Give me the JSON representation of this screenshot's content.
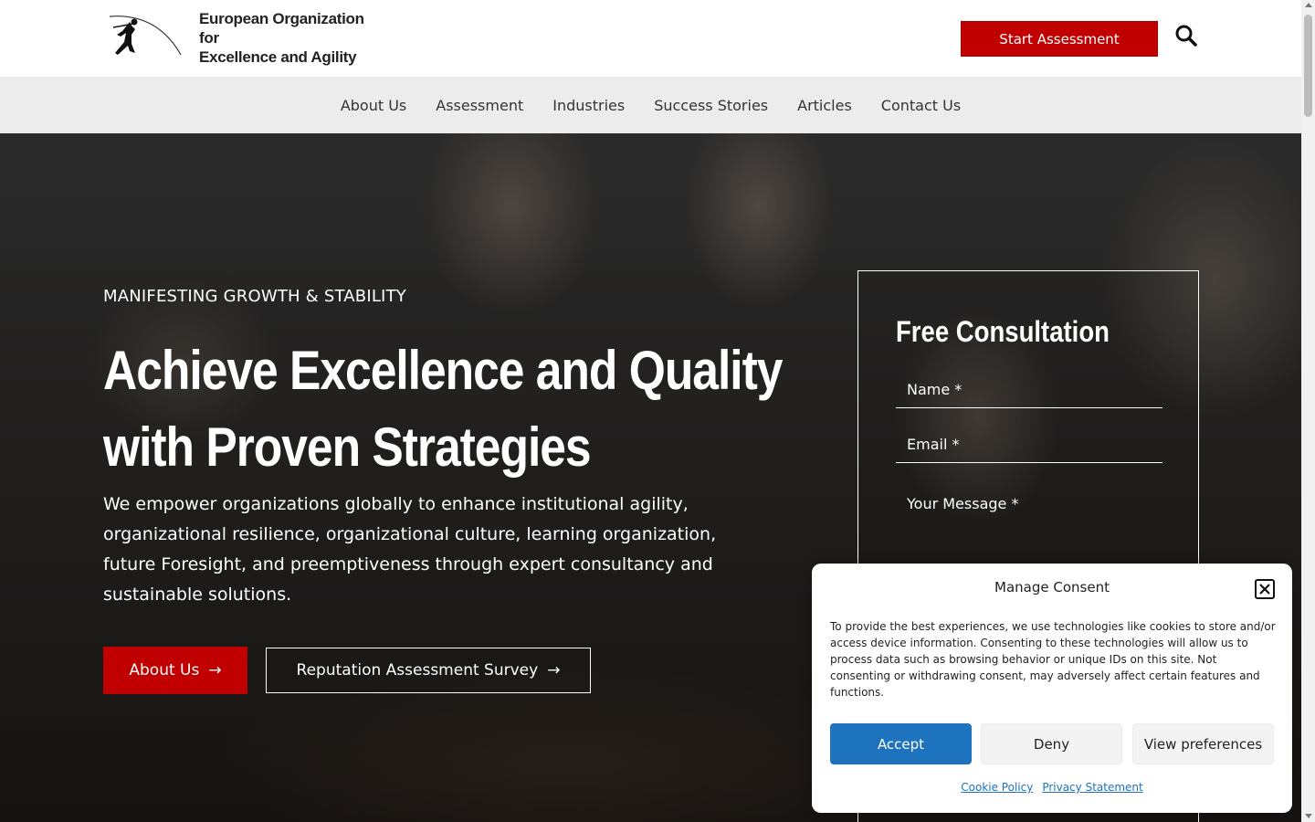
{
  "brand": {
    "name_line1": "European Organization for",
    "name_line2": "Excellence and Agility",
    "logo_icon": "pole-vaulter-icon"
  },
  "header": {
    "cta_label": "Start Assessment",
    "search_icon": "search-icon"
  },
  "nav": {
    "items": [
      "About Us",
      "Assessment",
      "Industries",
      "Success Stories",
      "Articles",
      "Contact Us"
    ]
  },
  "hero": {
    "kicker": "MANIFESTING GROWTH & STABILITY",
    "title": "Achieve Excellence and Quality with Proven Strategies",
    "description": "We empower organizations globally to enhance institutional agility, organizational resilience, organizational culture, learning organization, future Foresight, and preemptiveness through expert consultancy and sustainable solutions.",
    "primary_button": "About Us",
    "secondary_button": "Reputation Assessment Survey",
    "arrow_icon": "arrow-right-icon"
  },
  "consultation_form": {
    "title": "Free Consultation",
    "name_placeholder": "Name *",
    "email_placeholder": "Email *",
    "message_placeholder": "Your Message *"
  },
  "consent": {
    "title": "Manage Consent",
    "text": "To provide the best experiences, we use technologies like cookies to store and/or access device information. Consenting to these technologies will allow us to process data such as browsing behavior or unique IDs on this site. Not consenting or withdrawing consent, may adversely affect certain features and functions.",
    "accept_label": "Accept",
    "deny_label": "Deny",
    "preferences_label": "View preferences",
    "cookie_policy_label": "Cookie Policy",
    "privacy_label": "Privacy Statement"
  },
  "colors": {
    "brand_red": "#c00000",
    "accept_blue": "#1e73be",
    "nav_bg": "#ececec"
  }
}
